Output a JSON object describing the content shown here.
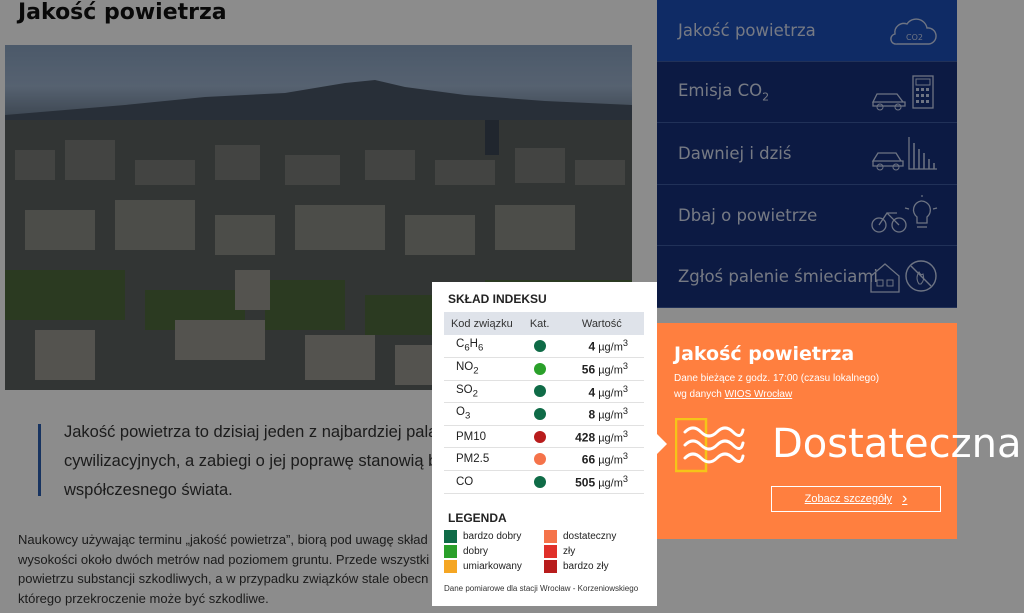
{
  "page": {
    "title": "Jakość powietrza",
    "quote": [
      "Jakość powietrza to dzisiaj jeden z najbardziej palą",
      "cywilizacyjnych, a zabiegi o jej poprawę stanowią ba",
      "współczesnego świata."
    ],
    "paragraph": [
      "Naukowcy używając terminu „jakość powietrza”, biorą pod uwagę skład",
      "wysokości około dwóch metrów nad poziomem gruntu. Przede wszystki",
      "powietrzu substancji szkodliwych, a w przypadku związków stale obecn",
      "którego przekroczenie może być szkodliwe."
    ]
  },
  "menu": {
    "items": [
      {
        "label": "Jakość powietrza",
        "icon": "cloud-co2-icon",
        "active": true
      },
      {
        "label_main": "Emisja CO",
        "label_sub": "2",
        "icon": "car-calculator-icon"
      },
      {
        "label": "Dawniej i dziś",
        "icon": "car-chart-icon"
      },
      {
        "label": "Dbaj o powietrze",
        "icon": "bike-bulb-icon"
      },
      {
        "label": "Zgłoś palenie śmieciami",
        "icon": "house-no-burning-icon"
      }
    ]
  },
  "aq_card": {
    "title": "Jakość powietrza",
    "sub_line1": "Dane bieżące z godz. 17:00 (czasu lokalnego)",
    "sub_line2_prefix": "wg danych ",
    "sub_link": "WIOS Wrocław",
    "status": "Dostateczna",
    "details_button": "Zobacz szczegóły",
    "details_arrow": "›",
    "color": "#ff7f3f"
  },
  "popup": {
    "title": "SKŁAD INDEKSU",
    "headers": {
      "code": "Kod związku",
      "cat": "Kat.",
      "value": "Wartość"
    },
    "rows": [
      {
        "code": "C",
        "sub1": "6",
        "mid": "H",
        "sub2": "6",
        "value": "4",
        "unit": "µg/m",
        "exp": "3",
        "color": "#0f6b47"
      },
      {
        "code": "NO",
        "sub1": "2",
        "value": "56",
        "unit": "µg/m",
        "exp": "3",
        "color": "#2aa02a"
      },
      {
        "code": "SO",
        "sub1": "2",
        "value": "4",
        "unit": "µg/m",
        "exp": "3",
        "color": "#0f6b47"
      },
      {
        "code": "O",
        "sub1": "3",
        "value": "8",
        "unit": "µg/m",
        "exp": "3",
        "color": "#0f6b47"
      },
      {
        "code": "PM10",
        "value": "428",
        "unit": "µg/m",
        "exp": "3",
        "color": "#b81c1c"
      },
      {
        "code": "PM2.5",
        "value": "66",
        "unit": "µg/m",
        "exp": "3",
        "color": "#f5734a"
      },
      {
        "code": "CO",
        "value": "505",
        "unit": "µg/m",
        "exp": "3",
        "color": "#0f6b47"
      }
    ],
    "legend_title": "LEGENDA",
    "legend": [
      {
        "label": "bardzo dobry",
        "color": "#0f6b47"
      },
      {
        "label": "dostateczny",
        "color": "#f5734a"
      },
      {
        "label": "dobry",
        "color": "#2aa02a"
      },
      {
        "label": "zły",
        "color": "#e0302a"
      },
      {
        "label": "umiarkowany",
        "color": "#f5a623"
      },
      {
        "label": "bardzo zły",
        "color": "#b81c1c"
      }
    ],
    "footnote": "Dane pomiarowe dla stacji Wrocław - Korzeniowskiego"
  }
}
